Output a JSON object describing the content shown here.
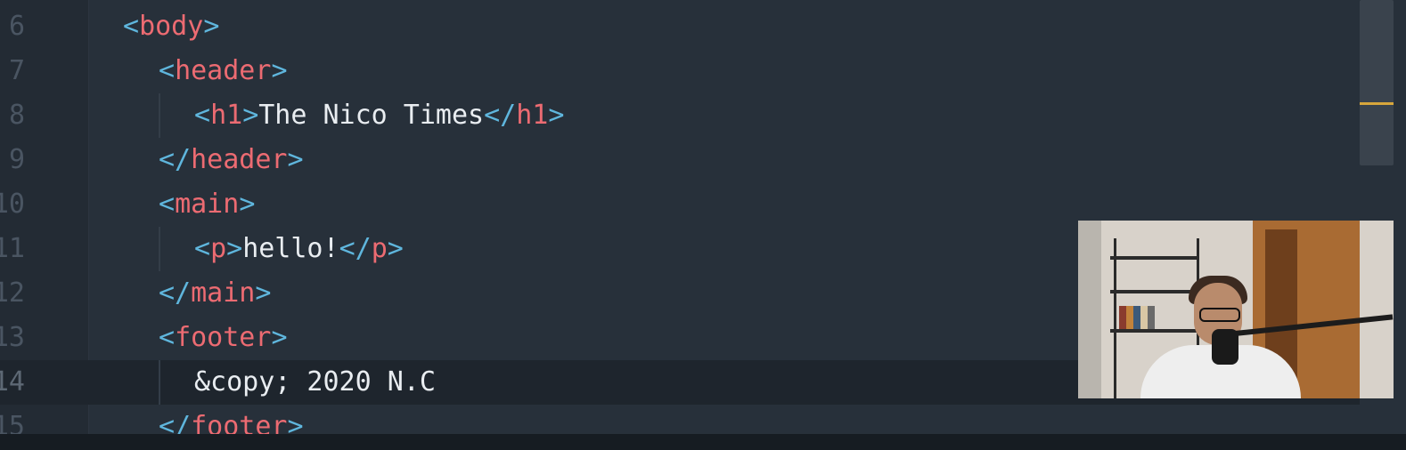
{
  "editor": {
    "lines": [
      {
        "num": "6",
        "indent": 0,
        "tokens": [
          {
            "t": "punct",
            "v": "<"
          },
          {
            "t": "tag",
            "v": "body"
          },
          {
            "t": "punct",
            "v": ">"
          }
        ]
      },
      {
        "num": "7",
        "indent": 1,
        "tokens": [
          {
            "t": "punct",
            "v": "<"
          },
          {
            "t": "tag",
            "v": "header"
          },
          {
            "t": "punct",
            "v": ">"
          }
        ]
      },
      {
        "num": "8",
        "indent": 2,
        "tokens": [
          {
            "t": "punct",
            "v": "<"
          },
          {
            "t": "tag",
            "v": "h1"
          },
          {
            "t": "punct",
            "v": ">"
          },
          {
            "t": "text",
            "v": "The Nico Times"
          },
          {
            "t": "punct",
            "v": "</"
          },
          {
            "t": "tag",
            "v": "h1"
          },
          {
            "t": "punct",
            "v": ">"
          }
        ]
      },
      {
        "num": "9",
        "indent": 1,
        "tokens": [
          {
            "t": "punct",
            "v": "</"
          },
          {
            "t": "tag",
            "v": "header"
          },
          {
            "t": "punct",
            "v": ">"
          }
        ]
      },
      {
        "num": "10",
        "indent": 1,
        "tokens": [
          {
            "t": "punct",
            "v": "<"
          },
          {
            "t": "tag",
            "v": "main"
          },
          {
            "t": "punct",
            "v": ">"
          }
        ]
      },
      {
        "num": "11",
        "indent": 2,
        "tokens": [
          {
            "t": "punct",
            "v": "<"
          },
          {
            "t": "tag",
            "v": "p"
          },
          {
            "t": "punct",
            "v": ">"
          },
          {
            "t": "text",
            "v": "hello!"
          },
          {
            "t": "punct",
            "v": "</"
          },
          {
            "t": "tag",
            "v": "p"
          },
          {
            "t": "punct",
            "v": ">"
          }
        ]
      },
      {
        "num": "12",
        "indent": 1,
        "tokens": [
          {
            "t": "punct",
            "v": "</"
          },
          {
            "t": "tag",
            "v": "main"
          },
          {
            "t": "punct",
            "v": ">"
          }
        ]
      },
      {
        "num": "13",
        "indent": 1,
        "tokens": [
          {
            "t": "punct",
            "v": "<"
          },
          {
            "t": "tag",
            "v": "footer"
          },
          {
            "t": "punct",
            "v": ">"
          }
        ]
      },
      {
        "num": "14",
        "indent": 2,
        "current": true,
        "tokens": [
          {
            "t": "text",
            "v": "&copy; 2020 N.C"
          }
        ]
      },
      {
        "num": "15",
        "indent": 1,
        "tokens": [
          {
            "t": "punct",
            "v": "</"
          },
          {
            "t": "tag",
            "v": "footer"
          },
          {
            "t": "punct",
            "v": ">"
          }
        ]
      }
    ]
  },
  "colors": {
    "background": "#27303a",
    "punctuation": "#5fb6dd",
    "tag": "#ec6b72",
    "text": "#e9edf1",
    "scroll_marker": "#d7a63c"
  },
  "webcam": {
    "icon": "webcam-feed"
  }
}
